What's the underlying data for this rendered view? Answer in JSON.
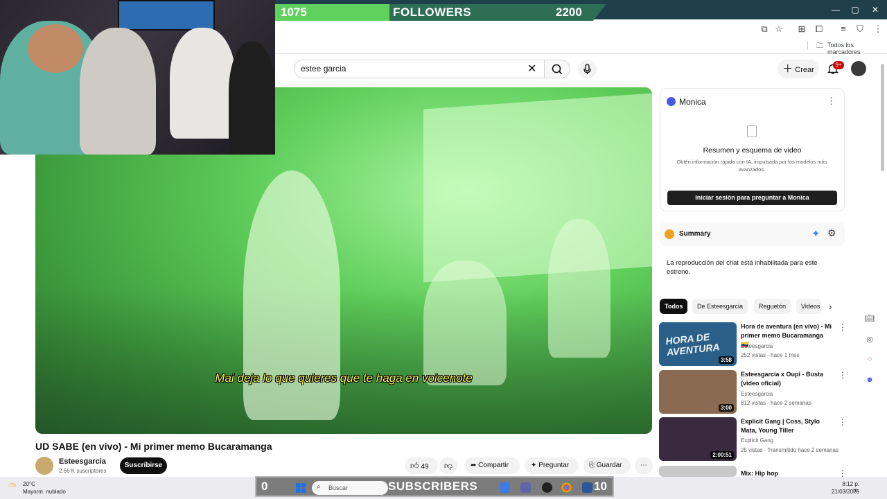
{
  "overlay": {
    "followers": {
      "current": "1075",
      "label": "FOLLOWERS",
      "goal": "2200",
      "progress_fraction": 0.35
    },
    "subscribers": {
      "current": "0",
      "label": "SUBSCRIBERS",
      "goal": "10"
    }
  },
  "browser": {
    "bookmarks_label": "Todos los marcadores",
    "window_controls": [
      "—",
      "▢",
      "✕"
    ]
  },
  "youtube": {
    "search": {
      "value": "estee garcia"
    },
    "create_label": "Crear",
    "notifications_badge": "9+"
  },
  "video": {
    "caption": "Mai deja lo que quieres que te haga en voicenote",
    "title": "UD SABE (en vivo) - Mi primer memo Bucaramanga",
    "channel": {
      "name": "Esteesgarcia",
      "subscribers": "2.66 K suscriptores"
    },
    "subscribe_label": "Suscribirse",
    "likes": "49",
    "share_label": "Compartir",
    "ask_label": "Preguntar",
    "save_label": "Guardar"
  },
  "monica": {
    "name": "Monica",
    "heading": "Resumen y esquema de video",
    "description": "Obtén información rápida con IA, impulsada por los modelos más avanzados.",
    "login_label": "Iniciar sesión para preguntar a Monica"
  },
  "summary": {
    "title": "Summary"
  },
  "chat": {
    "disabled_text": "La reproducción del chat está inhabilitada para este estreno."
  },
  "chips": [
    "Todos",
    "De Esteesgarcia",
    "Reguetón",
    "Videos"
  ],
  "recommendations": [
    {
      "title": "Hora de aventura (en vivo) - Mi primer memo Bucaramanga 🇨🇴",
      "channel": "Esteesgarcia",
      "meta": "252 vistas · hace 1 mes",
      "duration": "3:58",
      "thumb_text": "HORA DE AVENTURA",
      "thumb_color": "#2a5f8a"
    },
    {
      "title": "Esteesgarcia x Oupi - Busta (video oficial)",
      "channel": "Esteesgarcia",
      "meta": "812 vistas · hace 2 semanas",
      "duration": "3:00",
      "thumb_text": "",
      "thumb_color": "#8a6a50"
    },
    {
      "title": "Explicit Gang | Coss, Stylo Mata, Young Tiller",
      "channel": "Explicit Gang",
      "meta": "25 vistas · Transmitido hace 2 semanas",
      "duration": "2:00:51",
      "thumb_text": "",
      "thumb_color": "#3a2a40"
    },
    {
      "title": "Mix: Hip hop",
      "channel": "",
      "meta": "",
      "duration": "",
      "thumb_text": "",
      "thumb_color": "#c8c8c8"
    }
  ],
  "taskbar": {
    "weather_temp": "20°C",
    "weather_desc": "Mayorm. nublado",
    "search_placeholder": "Buscar",
    "time": "8:12 p. m.",
    "date": "21/03/2026"
  },
  "colors": {
    "chrome_top": "#1f3f4a",
    "followers_fill": "#5fd15c",
    "subscribe": "#0f0f0f",
    "caption": "#f5f05a"
  }
}
